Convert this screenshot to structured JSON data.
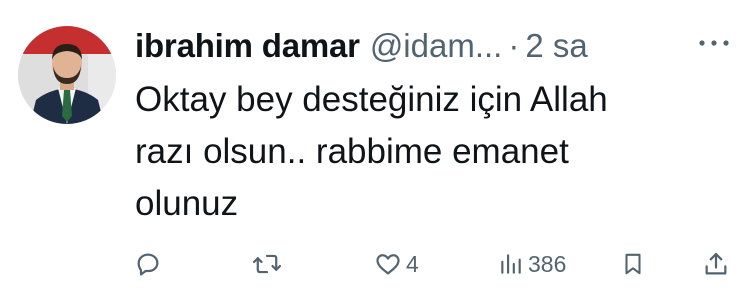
{
  "tweet": {
    "author_name": "ibrahim damar",
    "handle": "@idam...",
    "separator": "·",
    "time": "2 sa",
    "text": "Oktay bey desteğiniz için Allah\nrazı olsun.. rabbime emanet\nolunuz",
    "actions": {
      "reply_icon": "reply-icon",
      "retweet_icon": "retweet-icon",
      "like_icon": "heart-icon",
      "like_count": "4",
      "views_icon": "views-icon",
      "views_count": "386",
      "bookmark_icon": "bookmark-icon",
      "share_icon": "share-icon"
    },
    "more_icon": "more-icon"
  },
  "colors": {
    "text_primary": "#0f1419",
    "text_secondary": "#536471"
  }
}
